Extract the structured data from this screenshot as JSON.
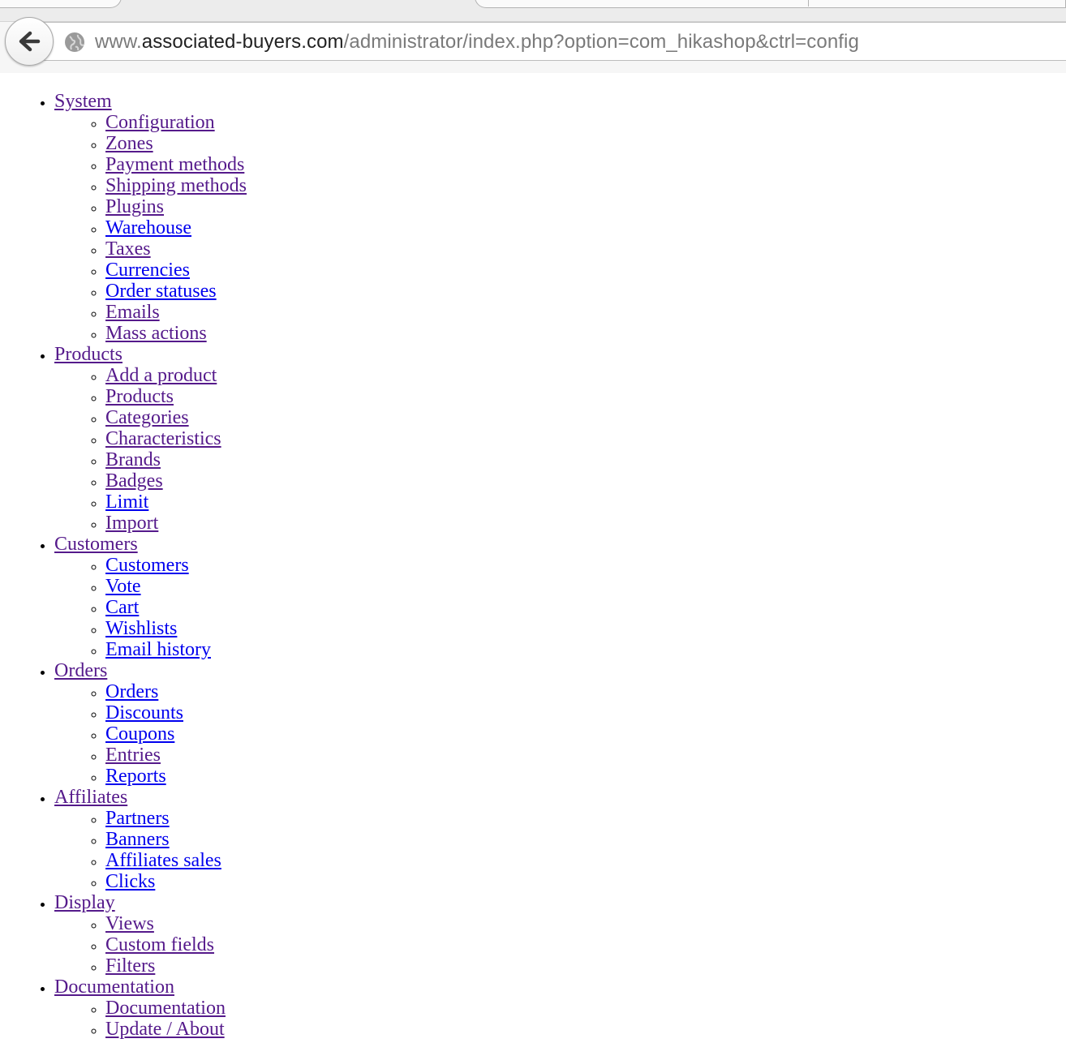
{
  "browser": {
    "url_host_prefix": "www.",
    "url_host": "associated-buyers.com",
    "url_path": "/administrator/index.php?option=com_hikashop&ctrl=config",
    "back_icon": "back-arrow-icon",
    "site_icon": "globe-icon"
  },
  "menu": [
    {
      "label": "System",
      "visited": true,
      "items": [
        {
          "label": "Configuration",
          "visited": true
        },
        {
          "label": "Zones",
          "visited": true
        },
        {
          "label": "Payment methods",
          "visited": true
        },
        {
          "label": "Shipping methods",
          "visited": true
        },
        {
          "label": "Plugins",
          "visited": true
        },
        {
          "label": "Warehouse",
          "visited": false
        },
        {
          "label": "Taxes",
          "visited": true
        },
        {
          "label": "Currencies",
          "visited": false
        },
        {
          "label": "Order statuses",
          "visited": false
        },
        {
          "label": "Emails",
          "visited": true
        },
        {
          "label": "Mass actions",
          "visited": true
        }
      ]
    },
    {
      "label": "Products",
      "visited": true,
      "items": [
        {
          "label": "Add a product",
          "visited": true
        },
        {
          "label": "Products",
          "visited": true
        },
        {
          "label": "Categories",
          "visited": true
        },
        {
          "label": "Characteristics",
          "visited": true
        },
        {
          "label": "Brands",
          "visited": true
        },
        {
          "label": "Badges",
          "visited": true
        },
        {
          "label": "Limit",
          "visited": false
        },
        {
          "label": "Import",
          "visited": true
        }
      ]
    },
    {
      "label": "Customers",
      "visited": true,
      "items": [
        {
          "label": "Customers",
          "visited": false
        },
        {
          "label": "Vote",
          "visited": false
        },
        {
          "label": "Cart",
          "visited": false
        },
        {
          "label": "Wishlists",
          "visited": false
        },
        {
          "label": "Email history",
          "visited": false
        }
      ]
    },
    {
      "label": "Orders",
      "visited": true,
      "items": [
        {
          "label": "Orders",
          "visited": false
        },
        {
          "label": "Discounts",
          "visited": false
        },
        {
          "label": "Coupons",
          "visited": false
        },
        {
          "label": "Entries",
          "visited": true
        },
        {
          "label": "Reports",
          "visited": false
        }
      ]
    },
    {
      "label": "Affiliates",
      "visited": true,
      "items": [
        {
          "label": "Partners",
          "visited": false
        },
        {
          "label": "Banners",
          "visited": false
        },
        {
          "label": "Affiliates sales",
          "visited": false
        },
        {
          "label": "Clicks",
          "visited": false
        }
      ]
    },
    {
      "label": "Display",
      "visited": true,
      "items": [
        {
          "label": "Views",
          "visited": true
        },
        {
          "label": "Custom fields",
          "visited": true
        },
        {
          "label": "Filters",
          "visited": true
        }
      ]
    },
    {
      "label": "Documentation",
      "visited": true,
      "items": [
        {
          "label": "Documentation",
          "visited": true
        },
        {
          "label": "Update / About",
          "visited": true
        }
      ]
    }
  ]
}
